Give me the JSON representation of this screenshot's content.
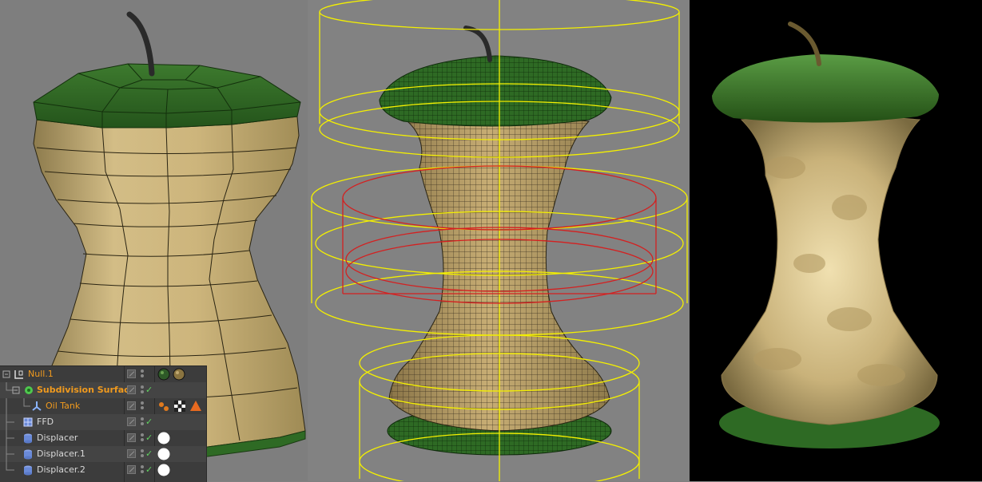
{
  "viewports": {
    "left": {
      "name": "low-poly apple core",
      "mode": "wireframe-shaded"
    },
    "middle": {
      "name": "subdivided apple core with deformer cages",
      "mode": "wireframe-shaded"
    },
    "right": {
      "name": "rendered apple core",
      "mode": "render"
    }
  },
  "colors": {
    "apple_skin": "#2e6a24",
    "flesh": "#c9b27a",
    "cage_yellow": "#f4f000",
    "cage_red": "#d42020",
    "selected_text": "#f09a1e",
    "panel_bg": "#3c3c3c"
  },
  "object_manager": {
    "objects": [
      {
        "name": "Null.1",
        "icon": "null-icon",
        "indent": 0,
        "selected": true,
        "bold": false,
        "tags": [
          "sphere-material-tag",
          "texture-material-tag"
        ]
      },
      {
        "name": "Subdivision Surface",
        "icon": "subdivision-surface-icon",
        "indent": 1,
        "selected": true,
        "bold": true,
        "tags": []
      },
      {
        "name": "Oil Tank",
        "icon": "oil-tank-icon",
        "indent": 2,
        "selected": true,
        "bold": false,
        "tags": [
          "phong-tag",
          "uvw-tag",
          "selection-tag"
        ]
      },
      {
        "name": "FFD",
        "icon": "ffd-icon",
        "indent": 1,
        "selected": false,
        "bold": false,
        "tags": []
      },
      {
        "name": "Displacer",
        "icon": "displacer-icon",
        "indent": 1,
        "selected": false,
        "bold": false,
        "tags": [
          "shader-tag"
        ]
      },
      {
        "name": "Displacer.1",
        "icon": "displacer-icon",
        "indent": 1,
        "selected": false,
        "bold": false,
        "tags": [
          "shader-tag"
        ]
      },
      {
        "name": "Displacer.2",
        "icon": "displacer-icon",
        "indent": 1,
        "selected": false,
        "bold": false,
        "tags": [
          "shader-tag"
        ]
      }
    ],
    "enabled_check": "✓"
  }
}
